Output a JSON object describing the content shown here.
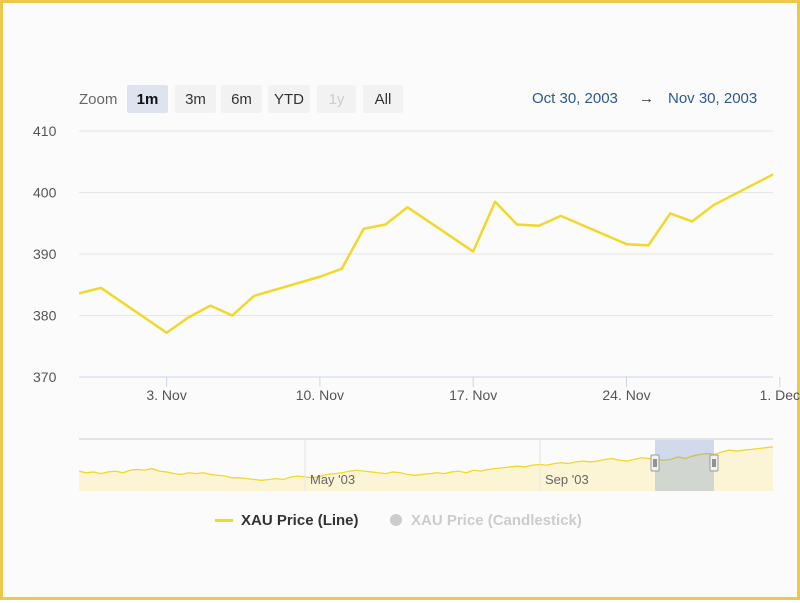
{
  "toolbar": {
    "zoom_label": "Zoom",
    "buttons": [
      {
        "label": "1m",
        "state": "active"
      },
      {
        "label": "3m",
        "state": "normal"
      },
      {
        "label": "6m",
        "state": "normal"
      },
      {
        "label": "YTD",
        "state": "normal"
      },
      {
        "label": "1y",
        "state": "disabled"
      },
      {
        "label": "All",
        "state": "normal"
      }
    ],
    "range_from": "Oct 30, 2003",
    "range_arrow": "→",
    "range_to": "Nov 30, 2003"
  },
  "chart_data": {
    "type": "line",
    "title": "",
    "xlabel": "",
    "ylabel": "",
    "line_color": "#f2d82a",
    "ylim": [
      370,
      410
    ],
    "y_ticks": [
      370,
      380,
      390,
      400,
      410
    ],
    "x_ticks": [
      "3. Nov",
      "10. Nov",
      "17. Nov",
      "24. Nov",
      "1. Dec"
    ],
    "series": [
      {
        "name": "XAU Price (Line)",
        "x": [
          "2003-10-30",
          "2003-10-31",
          "2003-11-03",
          "2003-11-04",
          "2003-11-05",
          "2003-11-06",
          "2003-11-07",
          "2003-11-10",
          "2003-11-11",
          "2003-11-12",
          "2003-11-13",
          "2003-11-14",
          "2003-11-17",
          "2003-11-18",
          "2003-11-19",
          "2003-11-20",
          "2003-11-21",
          "2003-11-24",
          "2003-11-25",
          "2003-11-26",
          "2003-11-27",
          "2003-11-28",
          "2003-12-01"
        ],
        "values": [
          383.6,
          384.5,
          377.2,
          379.7,
          381.6,
          380.0,
          383.2,
          386.3,
          387.6,
          394.1,
          394.8,
          397.6,
          390.4,
          398.5,
          394.8,
          394.6,
          396.2,
          391.6,
          391.4,
          396.6,
          395.3,
          398.0,
          403.5
        ]
      },
      {
        "name": "XAU Price (Candlestick)",
        "hidden": true,
        "values": []
      }
    ]
  },
  "navigator": {
    "labels": [
      "May '03",
      "Sep '03"
    ],
    "values": [
      374,
      372,
      373,
      371,
      373,
      374,
      372,
      375,
      376,
      375,
      377,
      374,
      373,
      371,
      370,
      372,
      371,
      372,
      370,
      369,
      368,
      366,
      366,
      365,
      364,
      363,
      364,
      365,
      364,
      367,
      368,
      367,
      366,
      368,
      370,
      371,
      372,
      374,
      375,
      374,
      373,
      372,
      371,
      373,
      372,
      370,
      369,
      370,
      371,
      372,
      371,
      373,
      374,
      372,
      375,
      374,
      376,
      377,
      378,
      379,
      380,
      379,
      381,
      382,
      381,
      383,
      384,
      383,
      385,
      386,
      385,
      386,
      388,
      389,
      387,
      386,
      388,
      390,
      389,
      388,
      387,
      388,
      391,
      389,
      392,
      394,
      395,
      394,
      397,
      399,
      398,
      399,
      400,
      401,
      402,
      403
    ]
  },
  "legend": {
    "items": [
      {
        "label": "XAU Price (Line)",
        "visible": true
      },
      {
        "label": "XAU Price (Candlestick)",
        "visible": false
      }
    ]
  }
}
